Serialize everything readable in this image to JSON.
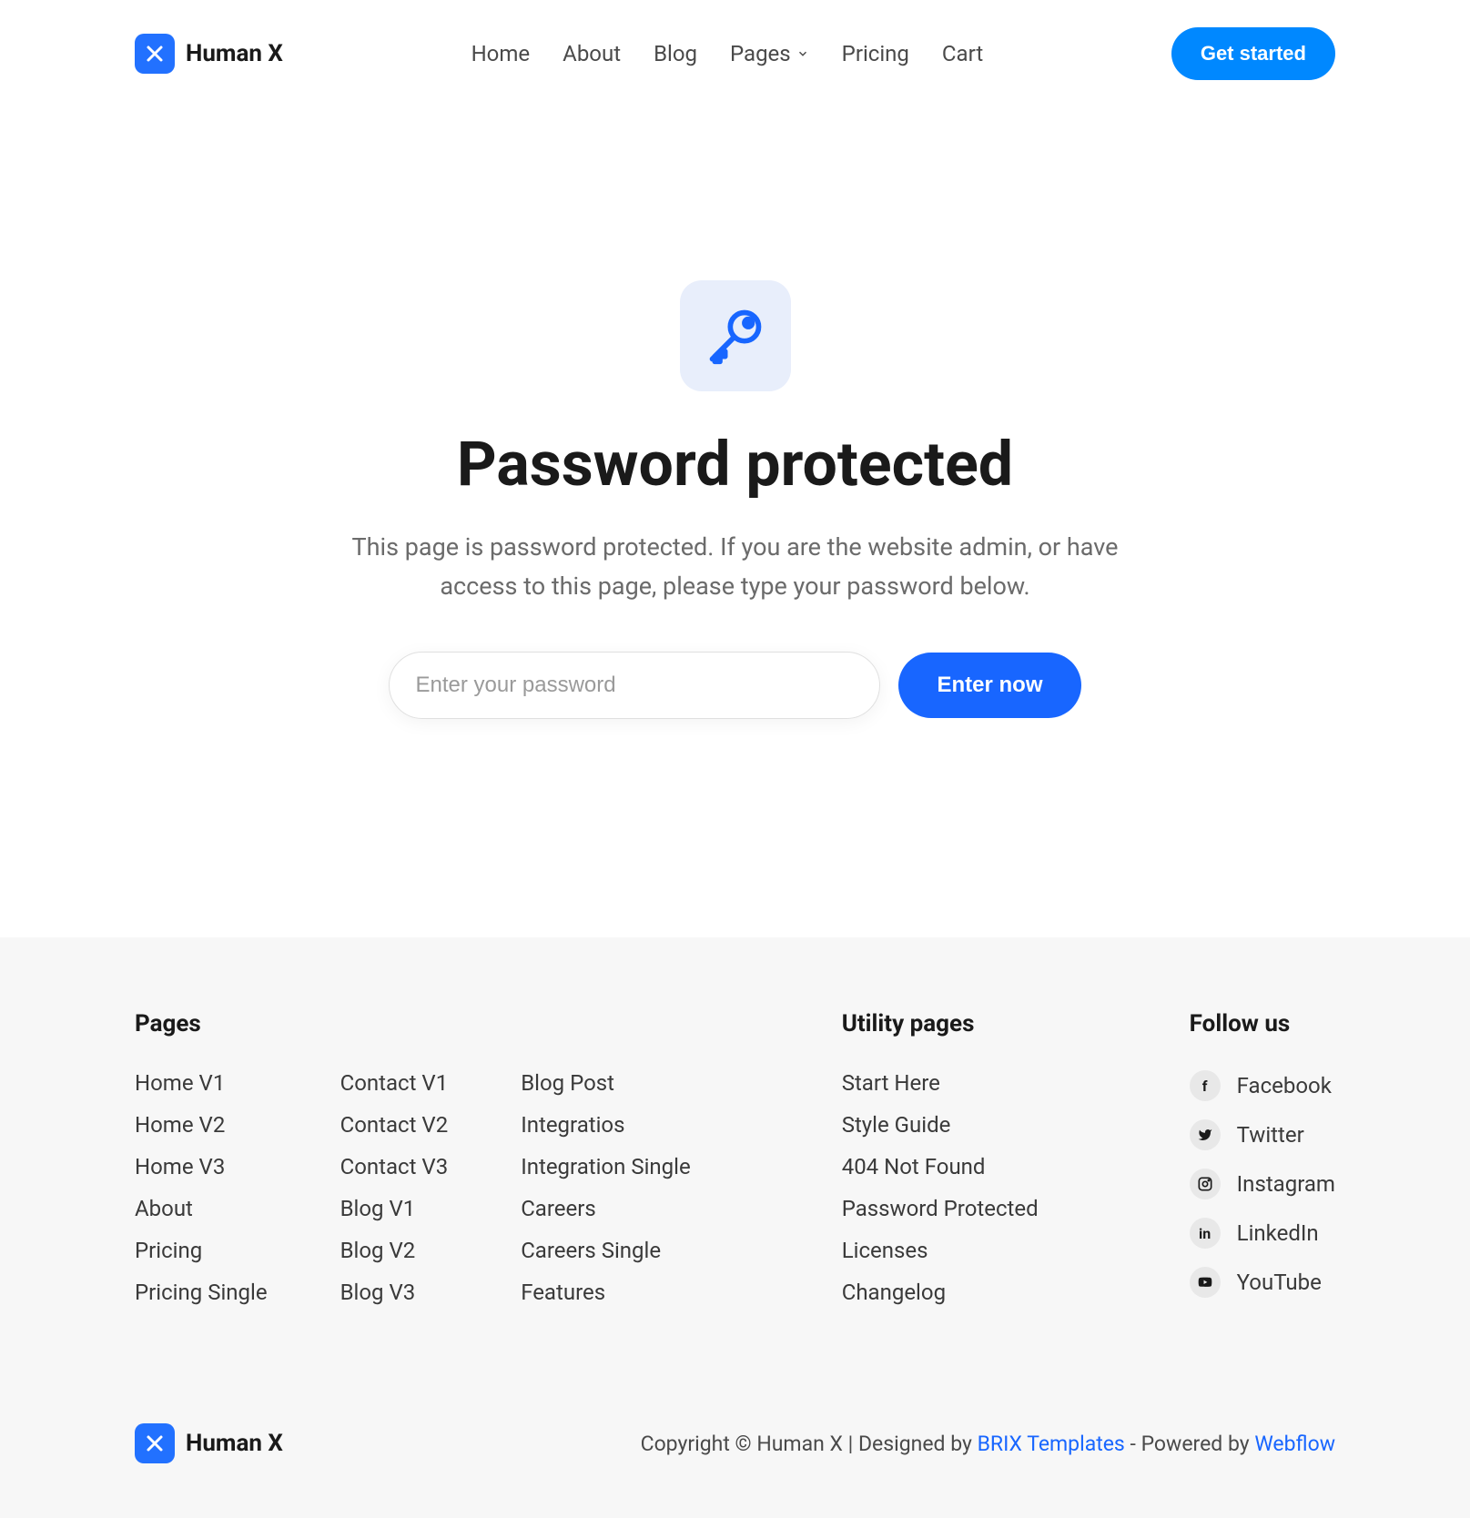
{
  "header": {
    "logo_text": "Human X",
    "nav": [
      "Home",
      "About",
      "Blog",
      "Pages",
      "Pricing",
      "Cart"
    ],
    "cta": "Get started"
  },
  "main": {
    "title": "Password protected",
    "description": "This page is password protected. If you are the website admin, or have access to this page, please type your password below.",
    "password_placeholder": "Enter your password",
    "submit_label": "Enter now"
  },
  "footer": {
    "pages_heading": "Pages",
    "utility_heading": "Utility pages",
    "follow_heading": "Follow us",
    "pages_col1": [
      "Home V1",
      "Home V2",
      "Home V3",
      "About",
      "Pricing",
      "Pricing Single"
    ],
    "pages_col2": [
      "Contact V1",
      "Contact V2",
      "Contact V3",
      "Blog V1",
      "Blog V2",
      "Blog V3"
    ],
    "pages_col3": [
      "Blog Post",
      "Integratios",
      "Integration Single",
      "Careers",
      "Careers Single",
      "Features"
    ],
    "utility": [
      "Start Here",
      "Style Guide",
      "404 Not Found",
      "Password Protected",
      "Licenses",
      "Changelog"
    ],
    "social": [
      "Facebook",
      "Twitter",
      "Instagram",
      "LinkedIn",
      "YouTube"
    ],
    "copyright_prefix": "Copyright © Human X | Designed by ",
    "copyright_link1": "BRIX Templates",
    "copyright_mid": " - Powered by ",
    "copyright_link2": "Webflow",
    "footer_logo": "Human X"
  }
}
